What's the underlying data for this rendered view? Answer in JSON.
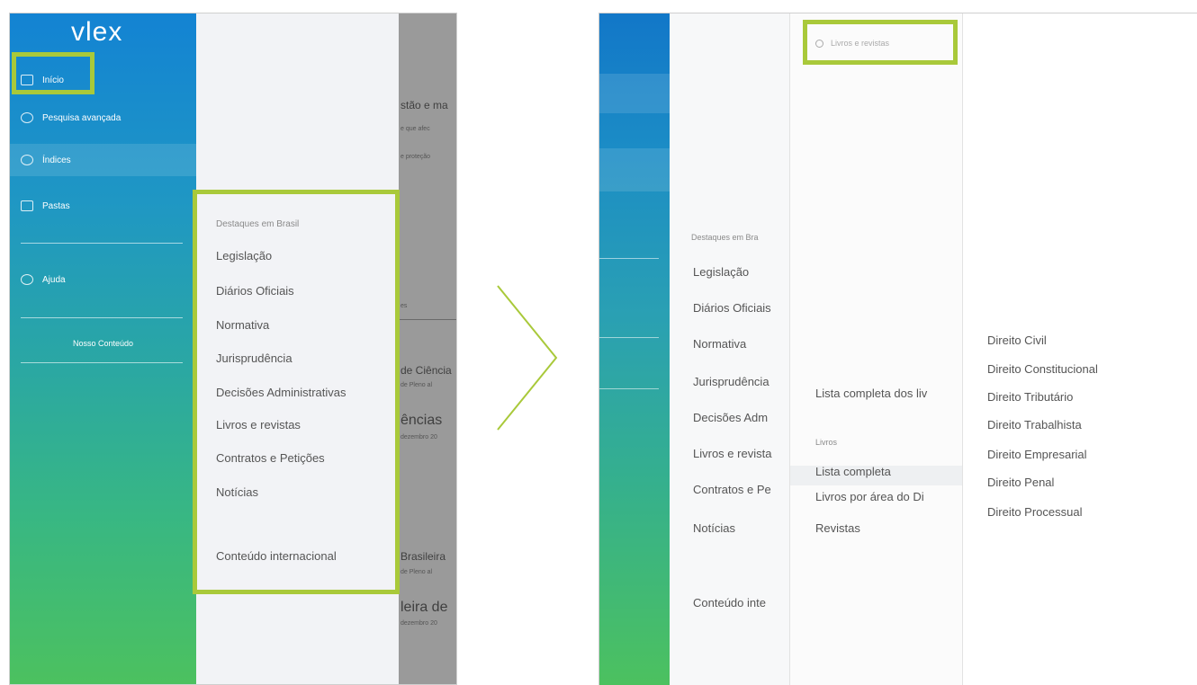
{
  "left": {
    "logo": "vlex",
    "nav": [
      {
        "label": "Início",
        "icon": "home-icon"
      },
      {
        "label": "Pesquisa avançada",
        "icon": "search-icon"
      },
      {
        "label": "Índices",
        "icon": "index-icon"
      },
      {
        "label": "Pastas",
        "icon": "folder-icon"
      },
      {
        "label": "Ajuda",
        "icon": "help-icon"
      }
    ],
    "account_link": "Nosso Conteúdo",
    "menu": {
      "section_title": "Destaques em Brasil",
      "items": [
        "Legislação",
        "Diários Oficiais",
        "Normativa",
        "Jurisprudência",
        "Decisões Administrativas",
        "Livros e revistas",
        "Contratos e Petições",
        "Notícias"
      ],
      "international": "Conteúdo internacional"
    },
    "overlay": {
      "snippets": [
        "stão e ma",
        "e que afec",
        "e proteção",
        "es",
        "de Ciência",
        "de Pleno al",
        "ências",
        "dezembro 20",
        "Brasileira",
        "de Pleno al",
        "leira de",
        "dezembro 20"
      ]
    }
  },
  "right": {
    "search_placeholder": "Livros e revistas",
    "menu": {
      "section_title": "Destaques em Bra",
      "items": [
        "Legislação",
        "Diários Oficiais",
        "Normativa",
        "Jurisprudência",
        "Decisões Adm",
        "Livros e revista",
        "Contratos e Pe",
        "Notícias"
      ],
      "international": "Conteúdo inte"
    },
    "livros": {
      "full_list_label": "Lista completa dos liv",
      "section_title": "Livros",
      "items": [
        "Lista completa",
        "Livros por área do Di",
        "Revistas"
      ]
    },
    "areas": [
      "Direito Civil",
      "Direito Constitucional",
      "Direito Tributário",
      "Direito Trabalhista",
      "Direito Empresarial",
      "Direito Penal",
      "Direito Processual"
    ]
  },
  "colors": {
    "highlight": "#a9c93a",
    "sidebar_top": "#1383d3",
    "sidebar_bottom": "#4cc15f",
    "arrow": "#a9c93a"
  }
}
